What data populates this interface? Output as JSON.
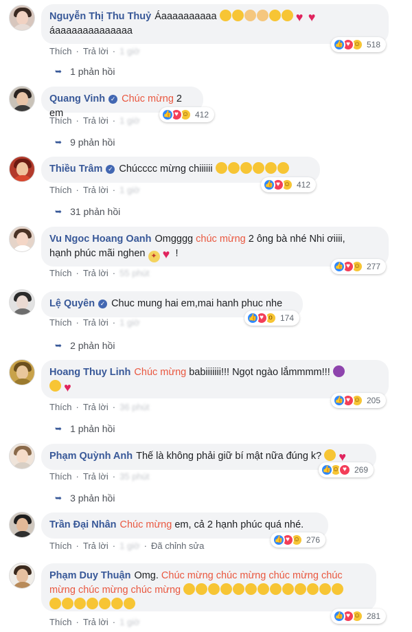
{
  "colors": {
    "name": "#385898",
    "highlight": "#e9573f",
    "bubble": "#f2f3f5",
    "meta": "#606770"
  },
  "actions": {
    "like": "Thích",
    "reply": "Trả lời"
  },
  "comments": [
    {
      "name": "Nguyễn Thị Thu Thuỷ",
      "verified": false,
      "text_parts": [
        "Áaaaaaaaaaa ",
        "",
        "áaaaaaaaaaaaaaa"
      ],
      "time": "1 giờ",
      "reaction_count": "518",
      "replies": "1 phản hồi"
    },
    {
      "name": "Quang Vinh",
      "verified": true,
      "text_parts": [
        "Chúc mừng",
        " 2 em"
      ],
      "time": "1 giờ",
      "reaction_count": "412",
      "replies": "9 phản hồi"
    },
    {
      "name": "Thiều Trâm",
      "verified": true,
      "text_parts": [
        "Chúcccc mừng chiiiiii "
      ],
      "time": "1 giờ",
      "reaction_count": "412",
      "replies": "31 phản hồi"
    },
    {
      "name": "Vu Ngoc Hoang Oanh",
      "text_parts": [
        "Omgggg ",
        "chúc mừng",
        " 2 ông bà nhé Nhi ơiiii,",
        "hạnh phúc mãi nghen ",
        " !"
      ],
      "time": "55 phút",
      "reaction_count": "277"
    },
    {
      "name": "Lệ Quyên",
      "verified": true,
      "text_parts": [
        "Chuc mung hai em,mai hanh phuc nhe"
      ],
      "time": "1 giờ",
      "reaction_count": "174",
      "replies": "2 phản hồi"
    },
    {
      "name": "Hoang Thuy Linh",
      "text_parts": [
        "Chúc mừng",
        " babiiiiiii!!! Ngọt ngào lắmmmm!!! "
      ],
      "time": "36 phút",
      "reaction_count": "205",
      "replies": "1 phản hồi"
    },
    {
      "name": "Phạm Quỳnh Anh",
      "text_parts": [
        "Thế là không phải giữ bí mật nữa đúng k? "
      ],
      "time": "35 phút",
      "reaction_count": "269",
      "replies": "3 phản hồi"
    },
    {
      "name": "Trần Đại Nhân",
      "text_parts": [
        "Chúc mừng",
        " em, cả 2 hạnh phúc quá nhé."
      ],
      "time": "1 giờ",
      "edited": "Đã chỉnh sửa",
      "reaction_count": "276"
    },
    {
      "name": "Phạm Duy Thuận",
      "text_parts": [
        "Omg. ",
        "Chúc mừng chúc mừng chúc mừng chúc",
        "mừng chúc mừng chúc mừng"
      ],
      "time": "1 giờ",
      "reaction_count": "281"
    }
  ]
}
